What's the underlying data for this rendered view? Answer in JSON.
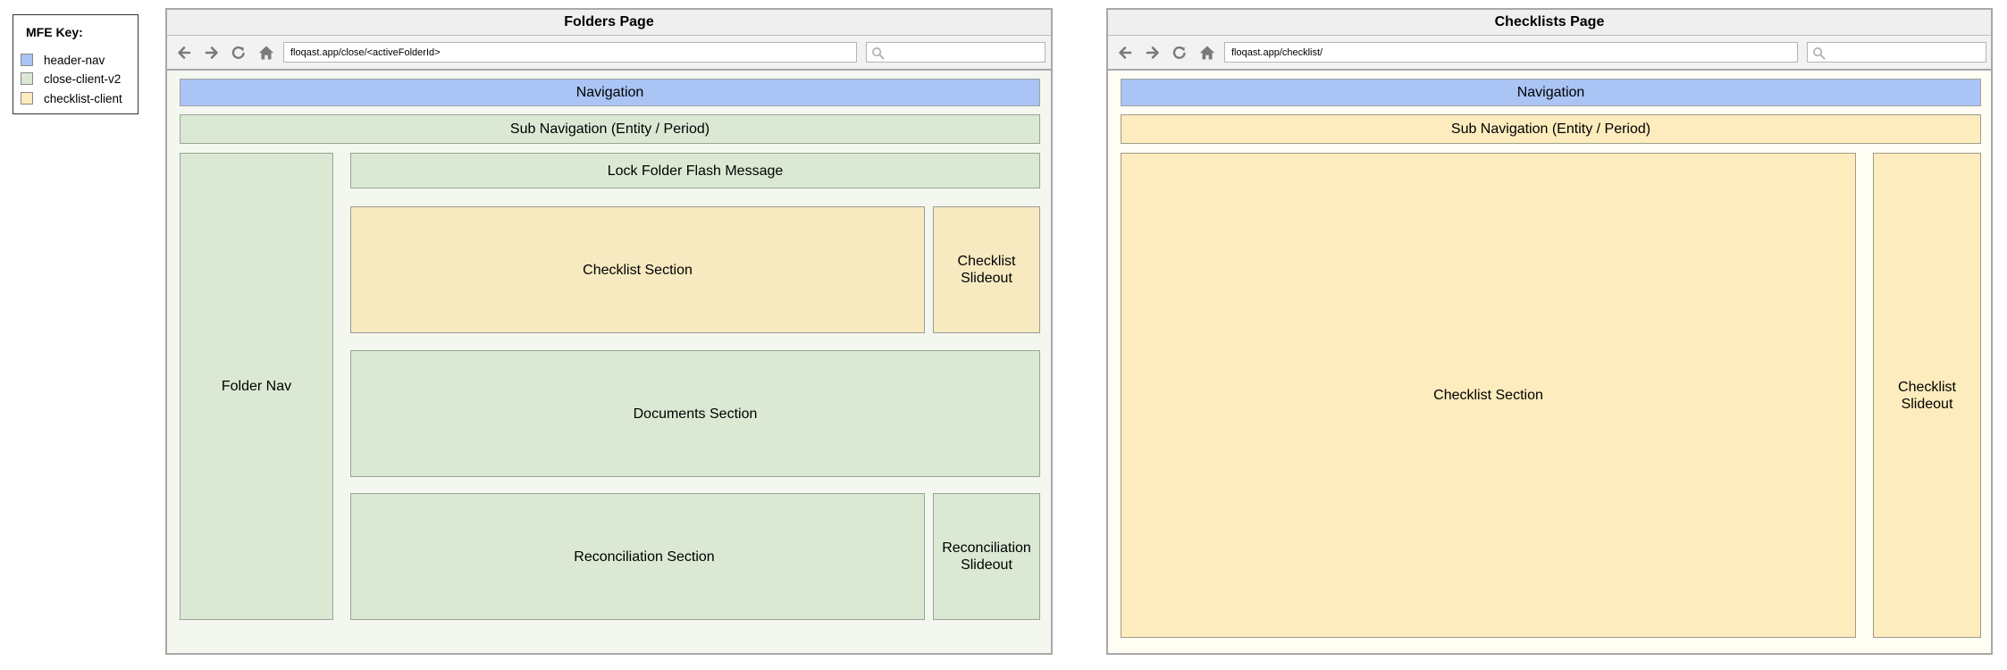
{
  "legend": {
    "title": "MFE Key:",
    "items": [
      {
        "label": "header-nav",
        "color": "#a9c4f5"
      },
      {
        "label": "close-client-v2",
        "color": "#dbe9d4"
      },
      {
        "label": "checklist-client",
        "color": "#fdecbd"
      }
    ]
  },
  "folders_page": {
    "title": "Folders Page",
    "url": "floqast.app/close/<activeFolderId>",
    "navigation": "Navigation",
    "sub_navigation": "Sub Navigation (Entity / Period)",
    "folder_nav": "Folder Nav",
    "lock_flash": "Lock Folder Flash Message",
    "checklist_section": "Checklist Section",
    "checklist_slideout": "Checklist Slideout",
    "documents_section": "Documents Section",
    "reconciliation_section": "Reconciliation Section",
    "reconciliation_slideout": "Reconciliation Slideout"
  },
  "checklists_page": {
    "title": "Checklists Page",
    "url": "floqast.app/checklist/",
    "navigation": "Navigation",
    "sub_navigation": "Sub Navigation (Entity / Period)",
    "checklist_section": "Checklist Section",
    "checklist_slideout": "Checklist Slideout"
  },
  "icons": [
    "arrow-left-icon",
    "arrow-right-icon",
    "refresh-icon",
    "home-icon",
    "search-icon"
  ]
}
